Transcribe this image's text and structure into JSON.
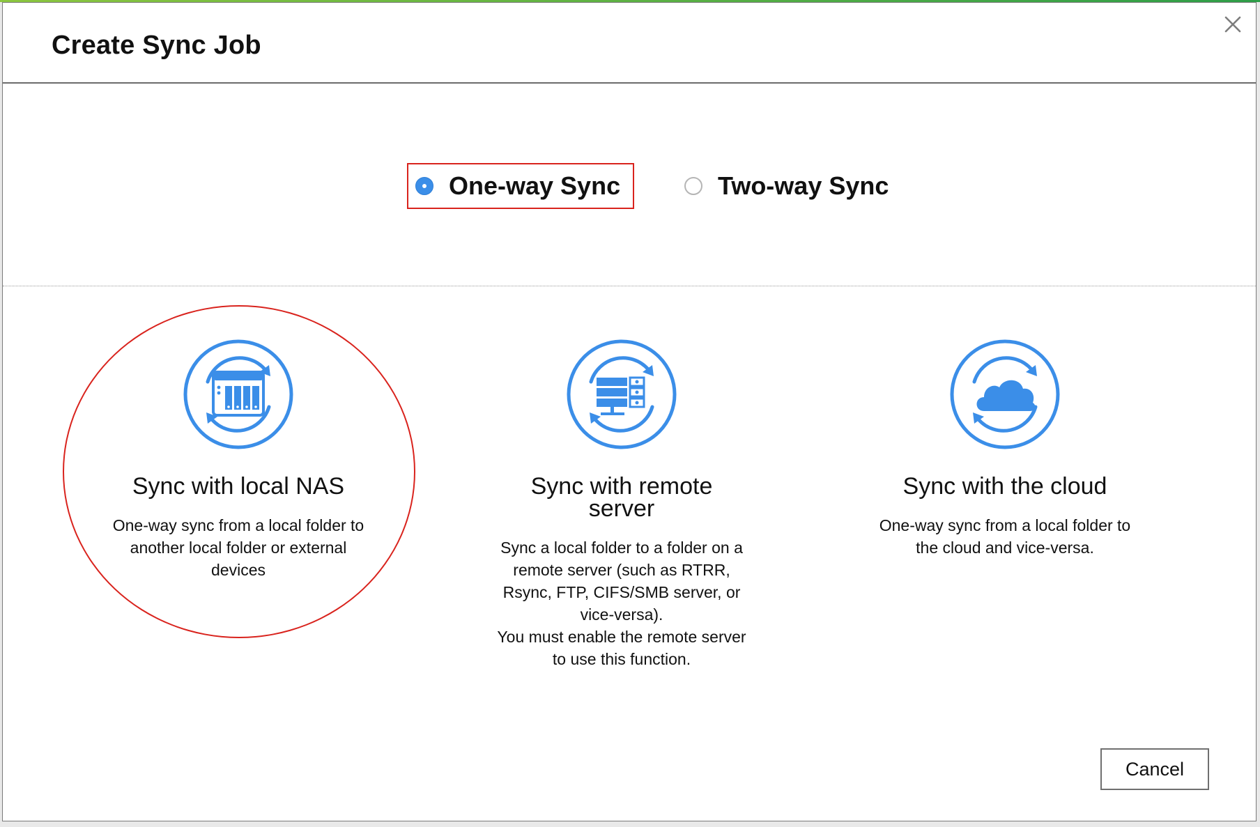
{
  "dialog": {
    "title": "Create Sync Job",
    "close_label": "×"
  },
  "sync_type": {
    "options": [
      {
        "label": "One-way Sync",
        "selected": true
      },
      {
        "label": "Two-way Sync",
        "selected": false
      }
    ]
  },
  "sync_targets": [
    {
      "title": "Sync with local NAS",
      "description": "One-way sync from a local folder to\nanother local folder or external\ndevices",
      "icon": "nas-sync-icon"
    },
    {
      "title": "Sync with remote\nserver",
      "description": "Sync a local folder to a folder on a\nremote server (such as RTRR,\nRsync, FTP, CIFS/SMB server, or\nvice-versa).\nYou must enable the remote server\nto use this function.",
      "icon": "remote-server-sync-icon"
    },
    {
      "title": "Sync with the cloud",
      "description": "One-way sync from a local folder to\nthe cloud and vice-versa.",
      "icon": "cloud-sync-icon"
    }
  ],
  "footer": {
    "cancel_label": "Cancel"
  },
  "colors": {
    "accent_blue": "#3b8ee8",
    "highlight_red": "#d9231d",
    "top_bar_green": "#2e9e48"
  }
}
